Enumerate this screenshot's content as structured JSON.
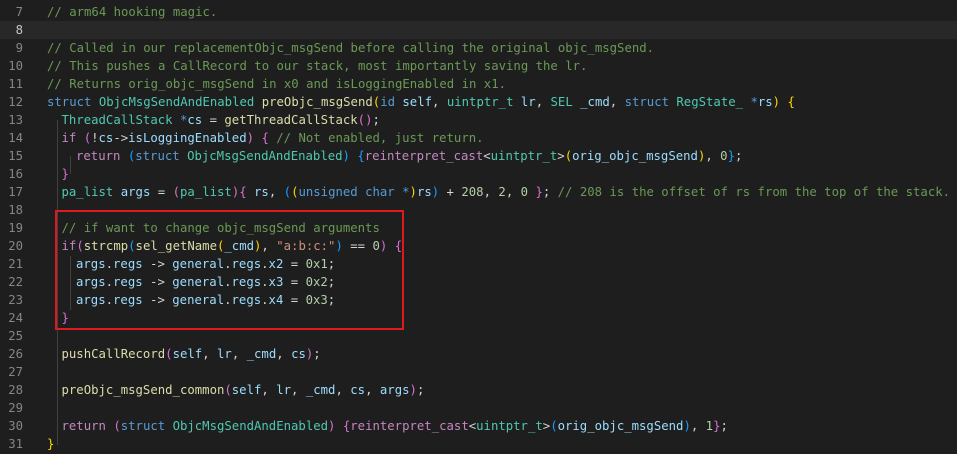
{
  "editor": {
    "theme": {
      "background": "#1e1e1e",
      "current_line": "#282828",
      "annotation_box": "#e0191c"
    },
    "current_line": "8",
    "lines": [
      {
        "n": "7",
        "t": [
          [
            "cm",
            "// arm64 hooking magic."
          ]
        ]
      },
      {
        "n": "8",
        "t": []
      },
      {
        "n": "9",
        "t": [
          [
            "cm",
            "// Called in our replacementObjc_msgSend before calling the original objc_msgSend."
          ]
        ]
      },
      {
        "n": "10",
        "t": [
          [
            "cm",
            "// This pushes a CallRecord to our stack, most importantly saving the lr."
          ]
        ]
      },
      {
        "n": "11",
        "t": [
          [
            "cm",
            "// Returns orig_objc_msgSend in x0 and isLoggingEnabled in x1."
          ]
        ]
      },
      {
        "n": "12",
        "t": [
          [
            "kw",
            "struct"
          ],
          [
            "pl",
            " "
          ],
          [
            "ty",
            "ObjcMsgSendAndEnabled"
          ],
          [
            "pl",
            " "
          ],
          [
            "fn",
            "preObjc_msgSend"
          ],
          [
            "b1",
            "("
          ],
          [
            "kw",
            "id"
          ],
          [
            "pl",
            " "
          ],
          [
            "var",
            "self"
          ],
          [
            "pl",
            ", "
          ],
          [
            "ty",
            "uintptr_t"
          ],
          [
            "pl",
            " "
          ],
          [
            "var",
            "lr"
          ],
          [
            "pl",
            ", "
          ],
          [
            "ty",
            "SEL"
          ],
          [
            "pl",
            " "
          ],
          [
            "var",
            "_cmd"
          ],
          [
            "pl",
            ", "
          ],
          [
            "kw",
            "struct"
          ],
          [
            "pl",
            " "
          ],
          [
            "ty",
            "RegState_"
          ],
          [
            "pl",
            " "
          ],
          [
            "kw",
            "*"
          ],
          [
            "var",
            "rs"
          ],
          [
            "b1",
            ")"
          ],
          [
            "pl",
            " "
          ],
          [
            "b1",
            "{"
          ]
        ]
      },
      {
        "n": "13",
        "t": [
          [
            "ty",
            "ThreadCallStack"
          ],
          [
            "pl",
            " "
          ],
          [
            "kw",
            "*"
          ],
          [
            "var",
            "cs"
          ],
          [
            "pl",
            " = "
          ],
          [
            "fn",
            "getThreadCallStack"
          ],
          [
            "b2",
            "()"
          ],
          [
            "pl",
            ";"
          ]
        ]
      },
      {
        "n": "14",
        "t": [
          [
            "ctl",
            "if"
          ],
          [
            "pl",
            " "
          ],
          [
            "b2",
            "("
          ],
          [
            "pl",
            "!"
          ],
          [
            "var",
            "cs"
          ],
          [
            "pl",
            "->"
          ],
          [
            "var",
            "isLoggingEnabled"
          ],
          [
            "b2",
            ")"
          ],
          [
            "pl",
            " "
          ],
          [
            "b2",
            "{"
          ],
          [
            "pl",
            " "
          ],
          [
            "cm",
            "// Not enabled, just return."
          ]
        ]
      },
      {
        "n": "15",
        "t": [
          [
            "ctl",
            "return"
          ],
          [
            "pl",
            " "
          ],
          [
            "b3",
            "("
          ],
          [
            "kw",
            "struct"
          ],
          [
            "pl",
            " "
          ],
          [
            "ty",
            "ObjcMsgSendAndEnabled"
          ],
          [
            "b3",
            ")"
          ],
          [
            "pl",
            " "
          ],
          [
            "b3",
            "{"
          ],
          [
            "ctl",
            "reinterpret_cast"
          ],
          [
            "pl",
            "<"
          ],
          [
            "ty",
            "uintptr_t"
          ],
          [
            "pl",
            ">"
          ],
          [
            "b1",
            "("
          ],
          [
            "var",
            "orig_objc_msgSend"
          ],
          [
            "b1",
            ")"
          ],
          [
            "pl",
            ", "
          ],
          [
            "num",
            "0"
          ],
          [
            "b3",
            "}"
          ],
          [
            "pl",
            ";"
          ]
        ]
      },
      {
        "n": "16",
        "t": [
          [
            "b2",
            "}"
          ]
        ]
      },
      {
        "n": "17",
        "t": [
          [
            "ty",
            "pa_list"
          ],
          [
            "pl",
            " "
          ],
          [
            "var",
            "args"
          ],
          [
            "pl",
            " = "
          ],
          [
            "b2",
            "("
          ],
          [
            "ty",
            "pa_list"
          ],
          [
            "b2",
            ")"
          ],
          [
            "b2",
            "{"
          ],
          [
            "pl",
            " "
          ],
          [
            "var",
            "rs"
          ],
          [
            "pl",
            ", "
          ],
          [
            "b3",
            "("
          ],
          [
            "b1",
            "("
          ],
          [
            "kw",
            "unsigned char"
          ],
          [
            "pl",
            " "
          ],
          [
            "kw",
            "*"
          ],
          [
            "b1",
            ")"
          ],
          [
            "var",
            "rs"
          ],
          [
            "b3",
            ")"
          ],
          [
            "pl",
            " + "
          ],
          [
            "num",
            "208"
          ],
          [
            "pl",
            ", "
          ],
          [
            "num",
            "2"
          ],
          [
            "pl",
            ", "
          ],
          [
            "num",
            "0"
          ],
          [
            "pl",
            " "
          ],
          [
            "b2",
            "}"
          ],
          [
            "pl",
            "; "
          ],
          [
            "cm",
            "// 208 is the offset of rs from the top of the stack."
          ]
        ]
      },
      {
        "n": "18",
        "t": []
      },
      {
        "n": "19",
        "t": [
          [
            "cm",
            "// if want to change objc_msgSend arguments"
          ]
        ]
      },
      {
        "n": "20",
        "t": [
          [
            "ctl",
            "if"
          ],
          [
            "b2",
            "("
          ],
          [
            "fn",
            "strcmp"
          ],
          [
            "b3",
            "("
          ],
          [
            "fn",
            "sel_getName"
          ],
          [
            "b1",
            "("
          ],
          [
            "var",
            "_cmd"
          ],
          [
            "b1",
            ")"
          ],
          [
            "pl",
            ", "
          ],
          [
            "str",
            "\"a:b:c:\""
          ],
          [
            "b3",
            ")"
          ],
          [
            "pl",
            " == "
          ],
          [
            "num",
            "0"
          ],
          [
            "b2",
            ")"
          ],
          [
            "pl",
            " "
          ],
          [
            "b2",
            "{"
          ]
        ]
      },
      {
        "n": "21",
        "t": [
          [
            "var",
            "args"
          ],
          [
            "pl",
            "."
          ],
          [
            "var",
            "regs"
          ],
          [
            "pl",
            " -> "
          ],
          [
            "var",
            "general"
          ],
          [
            "pl",
            "."
          ],
          [
            "var",
            "regs"
          ],
          [
            "pl",
            "."
          ],
          [
            "var",
            "x2"
          ],
          [
            "pl",
            " = "
          ],
          [
            "num",
            "0x1"
          ],
          [
            "pl",
            ";"
          ]
        ]
      },
      {
        "n": "22",
        "t": [
          [
            "var",
            "args"
          ],
          [
            "pl",
            "."
          ],
          [
            "var",
            "regs"
          ],
          [
            "pl",
            " -> "
          ],
          [
            "var",
            "general"
          ],
          [
            "pl",
            "."
          ],
          [
            "var",
            "regs"
          ],
          [
            "pl",
            "."
          ],
          [
            "var",
            "x3"
          ],
          [
            "pl",
            " = "
          ],
          [
            "num",
            "0x2"
          ],
          [
            "pl",
            ";"
          ]
        ]
      },
      {
        "n": "23",
        "t": [
          [
            "var",
            "args"
          ],
          [
            "pl",
            "."
          ],
          [
            "var",
            "regs"
          ],
          [
            "pl",
            " -> "
          ],
          [
            "var",
            "general"
          ],
          [
            "pl",
            "."
          ],
          [
            "var",
            "regs"
          ],
          [
            "pl",
            "."
          ],
          [
            "var",
            "x4"
          ],
          [
            "pl",
            " = "
          ],
          [
            "num",
            "0x3"
          ],
          [
            "pl",
            ";"
          ]
        ]
      },
      {
        "n": "24",
        "t": [
          [
            "b2",
            "}"
          ]
        ]
      },
      {
        "n": "25",
        "t": []
      },
      {
        "n": "26",
        "t": [
          [
            "fn",
            "pushCallRecord"
          ],
          [
            "b2",
            "("
          ],
          [
            "var",
            "self"
          ],
          [
            "pl",
            ", "
          ],
          [
            "var",
            "lr"
          ],
          [
            "pl",
            ", "
          ],
          [
            "var",
            "_cmd"
          ],
          [
            "pl",
            ", "
          ],
          [
            "var",
            "cs"
          ],
          [
            "b2",
            ")"
          ],
          [
            "pl",
            ";"
          ]
        ]
      },
      {
        "n": "27",
        "t": []
      },
      {
        "n": "28",
        "t": [
          [
            "fn",
            "preObjc_msgSend_common"
          ],
          [
            "b2",
            "("
          ],
          [
            "var",
            "self"
          ],
          [
            "pl",
            ", "
          ],
          [
            "var",
            "lr"
          ],
          [
            "pl",
            ", "
          ],
          [
            "var",
            "_cmd"
          ],
          [
            "pl",
            ", "
          ],
          [
            "var",
            "cs"
          ],
          [
            "pl",
            ", "
          ],
          [
            "var",
            "args"
          ],
          [
            "b2",
            ")"
          ],
          [
            "pl",
            ";"
          ]
        ]
      },
      {
        "n": "29",
        "t": []
      },
      {
        "n": "30",
        "t": [
          [
            "ctl",
            "return"
          ],
          [
            "pl",
            " "
          ],
          [
            "b2",
            "("
          ],
          [
            "kw",
            "struct"
          ],
          [
            "pl",
            " "
          ],
          [
            "ty",
            "ObjcMsgSendAndEnabled"
          ],
          [
            "b2",
            ")"
          ],
          [
            "pl",
            " "
          ],
          [
            "b2",
            "{"
          ],
          [
            "ctl",
            "reinterpret_cast"
          ],
          [
            "pl",
            "<"
          ],
          [
            "ty",
            "uintptr_t"
          ],
          [
            "pl",
            ">"
          ],
          [
            "b3",
            "("
          ],
          [
            "var",
            "orig_objc_msgSend"
          ],
          [
            "b3",
            ")"
          ],
          [
            "pl",
            ", "
          ],
          [
            "num",
            "1"
          ],
          [
            "b2",
            "}"
          ],
          [
            "pl",
            ";"
          ]
        ]
      },
      {
        "n": "31",
        "t": [
          [
            "b1",
            "}"
          ]
        ]
      }
    ]
  }
}
